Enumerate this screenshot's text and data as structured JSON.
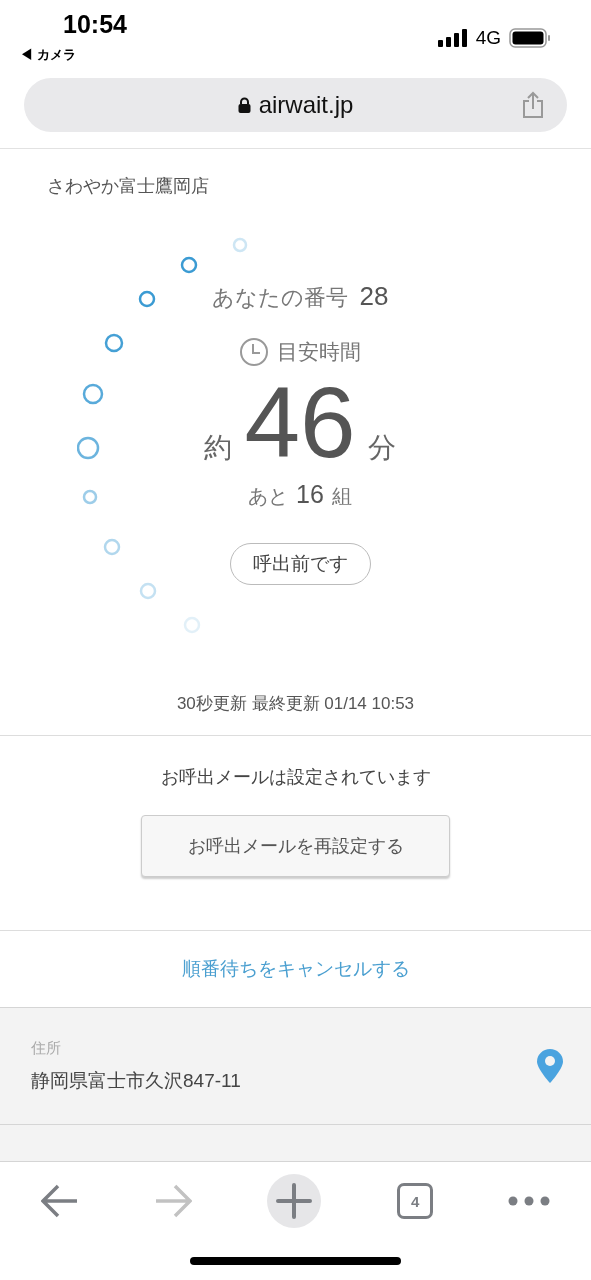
{
  "status_bar": {
    "time": "10:54",
    "back_app": "◀ カメラ",
    "network": "4G"
  },
  "address_bar": {
    "url": "airwait.jp"
  },
  "store_name": "さわやか富士鷹岡店",
  "ticket": {
    "number_label": "あなたの番号",
    "number": "28",
    "estimate_label": "目安時間",
    "prefix": "約",
    "minutes": "46",
    "unit": "分",
    "remaining_prefix": "あと",
    "remaining": "16",
    "remaining_unit": "組",
    "status": "呼出前です"
  },
  "update_note": "30秒更新 最終更新 01/14 10:53",
  "mail": {
    "message": "お呼出メールは設定されています",
    "button": "お呼出メールを再設定する"
  },
  "cancel_link": "順番待ちをキャンセルする",
  "info": [
    {
      "label": "住所",
      "value": "静岡県富士市久沢847-11",
      "kind": "address"
    }
  ],
  "toolbar": [
    {
      "kind": "back",
      "disabled": false
    },
    {
      "kind": "forward",
      "disabled": true
    },
    {
      "kind": "new_tab",
      "disabled": false
    },
    {
      "kind": "tabs",
      "count": "4",
      "disabled": false
    },
    {
      "kind": "more",
      "disabled": false
    }
  ]
}
